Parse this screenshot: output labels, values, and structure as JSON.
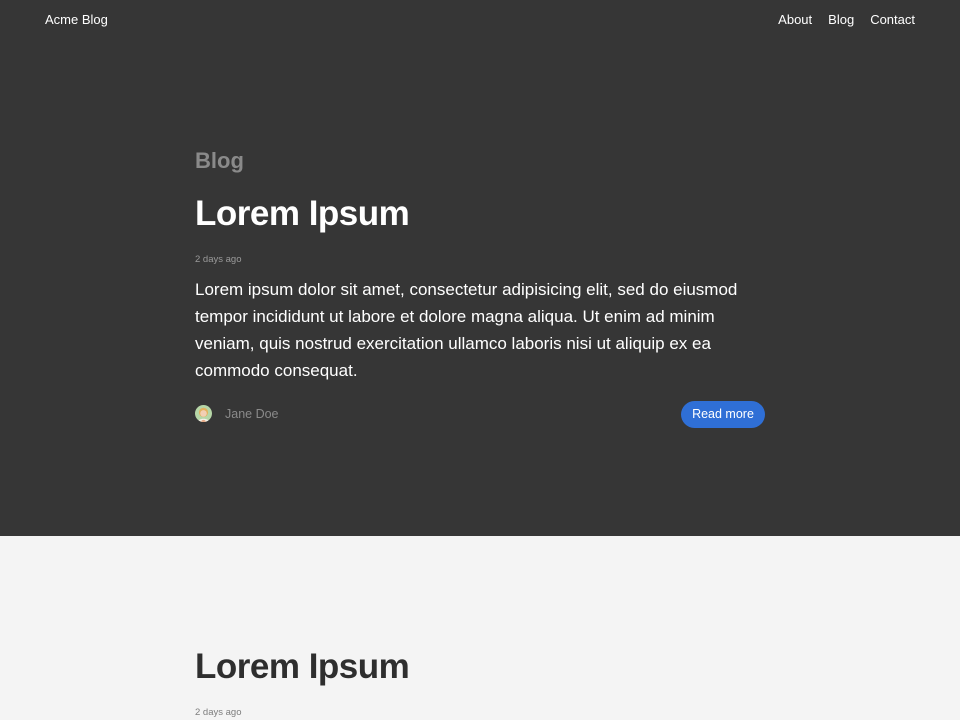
{
  "nav": {
    "brand": "Acme Blog",
    "links": [
      "About",
      "Blog",
      "Contact"
    ]
  },
  "featured_post": {
    "section_label": "Blog",
    "title": "Lorem Ipsum",
    "date": "2 days ago",
    "excerpt": "Lorem ipsum dolor sit amet, consectetur adipisicing elit, sed do eiusmod tempor incididunt ut labore et dolore magna aliqua. Ut enim ad minim veniam, quis nostrud exercitation ullamco laboris nisi ut aliquip ex ea commodo consequat.",
    "author": "Jane Doe",
    "read_more_label": "Read more"
  },
  "next_post": {
    "title": "Lorem Ipsum",
    "date": "2 days ago"
  },
  "colors": {
    "hero_background": "#363636",
    "page_background": "#f4f4f4",
    "accent": "#2f6fd6"
  }
}
